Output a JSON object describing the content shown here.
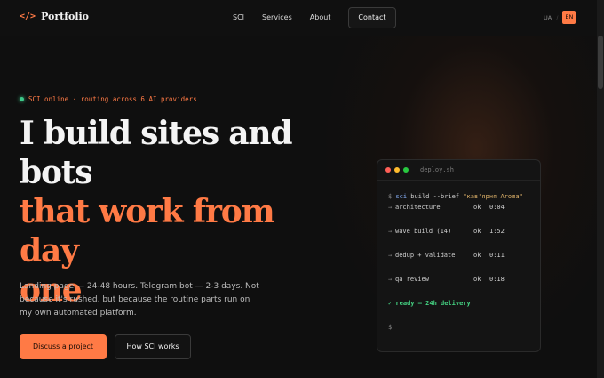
{
  "nav": {
    "logo_icon": "</>",
    "logo_text": "Portfolio",
    "links": [
      "SCI",
      "Services",
      "About"
    ],
    "contact": "Contact",
    "lang_ua": "UA",
    "lang_sep": "/",
    "lang_en": "EN"
  },
  "hero": {
    "status": "SCI online · routing across 6 AI providers",
    "headline_white_1": "I build sites and",
    "headline_white_2": "bots",
    "headline_orange_1": "that work from day",
    "headline_orange_2": "one",
    "sub": "Landing page — 24-48 hours. Telegram bot — 2-3 days. Not because it's rushed, but because the routine parts run on my own automated platform.",
    "btn_primary": "Discuss a project",
    "btn_secondary": "How SCI works"
  },
  "terminal": {
    "title": "deploy.sh",
    "prompt": "$",
    "cmd_kw": "sci",
    "cmd_rest": " build --brief ",
    "cmd_str": "\"кав'ярня Aroma\"",
    "rows": [
      {
        "arrow": "→",
        "task": "architecture",
        "ok": "ok",
        "time": "0:04"
      },
      {
        "arrow": "→",
        "task": "wave build (14)",
        "ok": "ok",
        "time": "1:52"
      },
      {
        "arrow": "→",
        "task": "dedup + validate",
        "ok": "ok",
        "time": "0:11"
      },
      {
        "arrow": "→",
        "task": "qa review",
        "ok": "ok",
        "time": "0:18"
      }
    ],
    "ready": "✓ ready — 24h delivery",
    "final_prompt": "$"
  },
  "colors": {
    "accent": "#ff7a45",
    "background": "#0f0f0f",
    "status_dot": "#3ec98a",
    "ready": "#45d483"
  }
}
